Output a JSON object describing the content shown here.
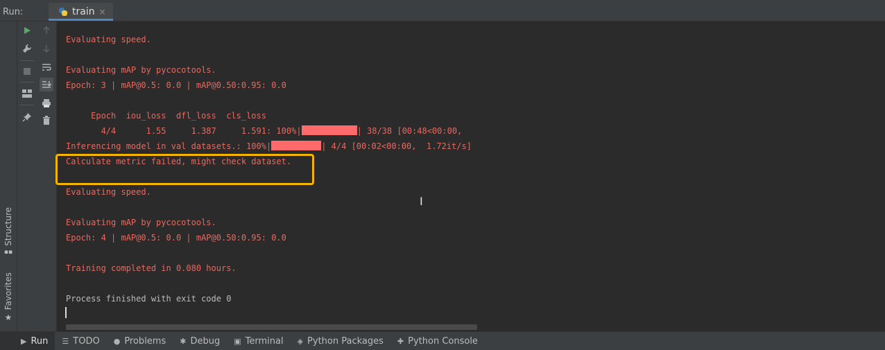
{
  "run_panel": {
    "label": "Run:",
    "tab": {
      "name": "train",
      "close": "×"
    }
  },
  "side_tabs": {
    "structure": "Structure",
    "favorites": "Favorites"
  },
  "tool_icons": {
    "rerun": "play-icon",
    "settings": "wrench-icon",
    "stop": "stop-icon",
    "layout": "layout-icon",
    "pin": "pin-icon",
    "up": "arrow-up-icon",
    "down": "arrow-down-icon",
    "wrap": "soft-wrap-icon",
    "scroll_end": "scroll-to-end-icon",
    "print": "print-icon",
    "trash": "trash-icon"
  },
  "console": {
    "lines": [
      "Evaluating speed.",
      "Evaluating mAP by pycocotools.",
      "Epoch: 3 | mAP@0.5: 0.0 | mAP@0.50:0.95: 0.0",
      "     Epoch  iou_loss  dfl_loss  cls_loss",
      "Inferencing model in val datasets.: 100%|",
      "| 4/4 [00:02<00:00,  1.72it/s]",
      "Calculate metric failed, might check dataset.",
      "Evaluating speed.",
      "Evaluating mAP by pycocotools.",
      "Epoch: 4 | mAP@0.5: 0.0 | mAP@0.50:0.95: 0.0",
      "Training completed in 0.080 hours.",
      "Process finished with exit code 0"
    ],
    "progress_row": {
      "prefix": "       4/4      1.55     1.387     1.591: 100%|",
      "suffix": "| 38/38 [00:48<00:00,",
      "progress": 1.0
    },
    "inference_progress": 1.0
  },
  "bottom_tabs": [
    {
      "label": "Run",
      "icon": "play-icon"
    },
    {
      "label": "TODO",
      "icon": "list-icon"
    },
    {
      "label": "Problems",
      "icon": "info-icon"
    },
    {
      "label": "Debug",
      "icon": "bug-icon"
    },
    {
      "label": "Terminal",
      "icon": "terminal-icon"
    },
    {
      "label": "Python Packages",
      "icon": "layers-icon"
    },
    {
      "label": "Python Console",
      "icon": "python-icon"
    }
  ],
  "colors": {
    "error_text": "#e36b62",
    "progress_fill": "#ff6b6b",
    "highlight": "#f5b400",
    "accent": "#4a88c7"
  }
}
